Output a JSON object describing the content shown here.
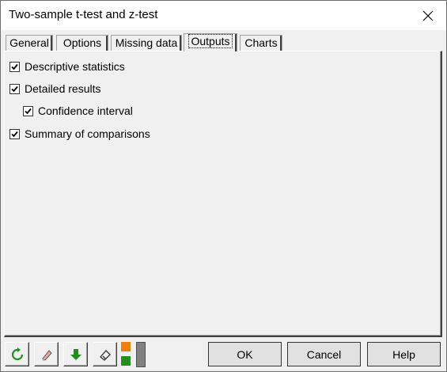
{
  "window": {
    "title": "Two-sample t-test and z-test"
  },
  "tabs": [
    {
      "label": "General"
    },
    {
      "label": "Options"
    },
    {
      "label": "Missing data"
    },
    {
      "label": "Outputs",
      "active": true
    },
    {
      "label": "Charts"
    }
  ],
  "outputs": {
    "descriptive_statistics": {
      "label": "Descriptive statistics",
      "checked": true
    },
    "detailed_results": {
      "label": "Detailed results",
      "checked": true
    },
    "confidence_interval": {
      "label": "Confidence interval",
      "checked": true
    },
    "summary_of_comparisons": {
      "label": "Summary of comparisons",
      "checked": true
    }
  },
  "toolbar": {
    "reset_icon": "reset-icon",
    "eraser_icon": "eraser-icon",
    "download_icon": "down-arrow-icon",
    "clear_icon": "clear-selection-icon",
    "color_toggle_icon": "color-toggle-icon",
    "colors": {
      "orange": "#f07f09",
      "green": "#1f8f1f"
    }
  },
  "buttons": {
    "ok": "OK",
    "cancel": "Cancel",
    "help": "Help"
  }
}
